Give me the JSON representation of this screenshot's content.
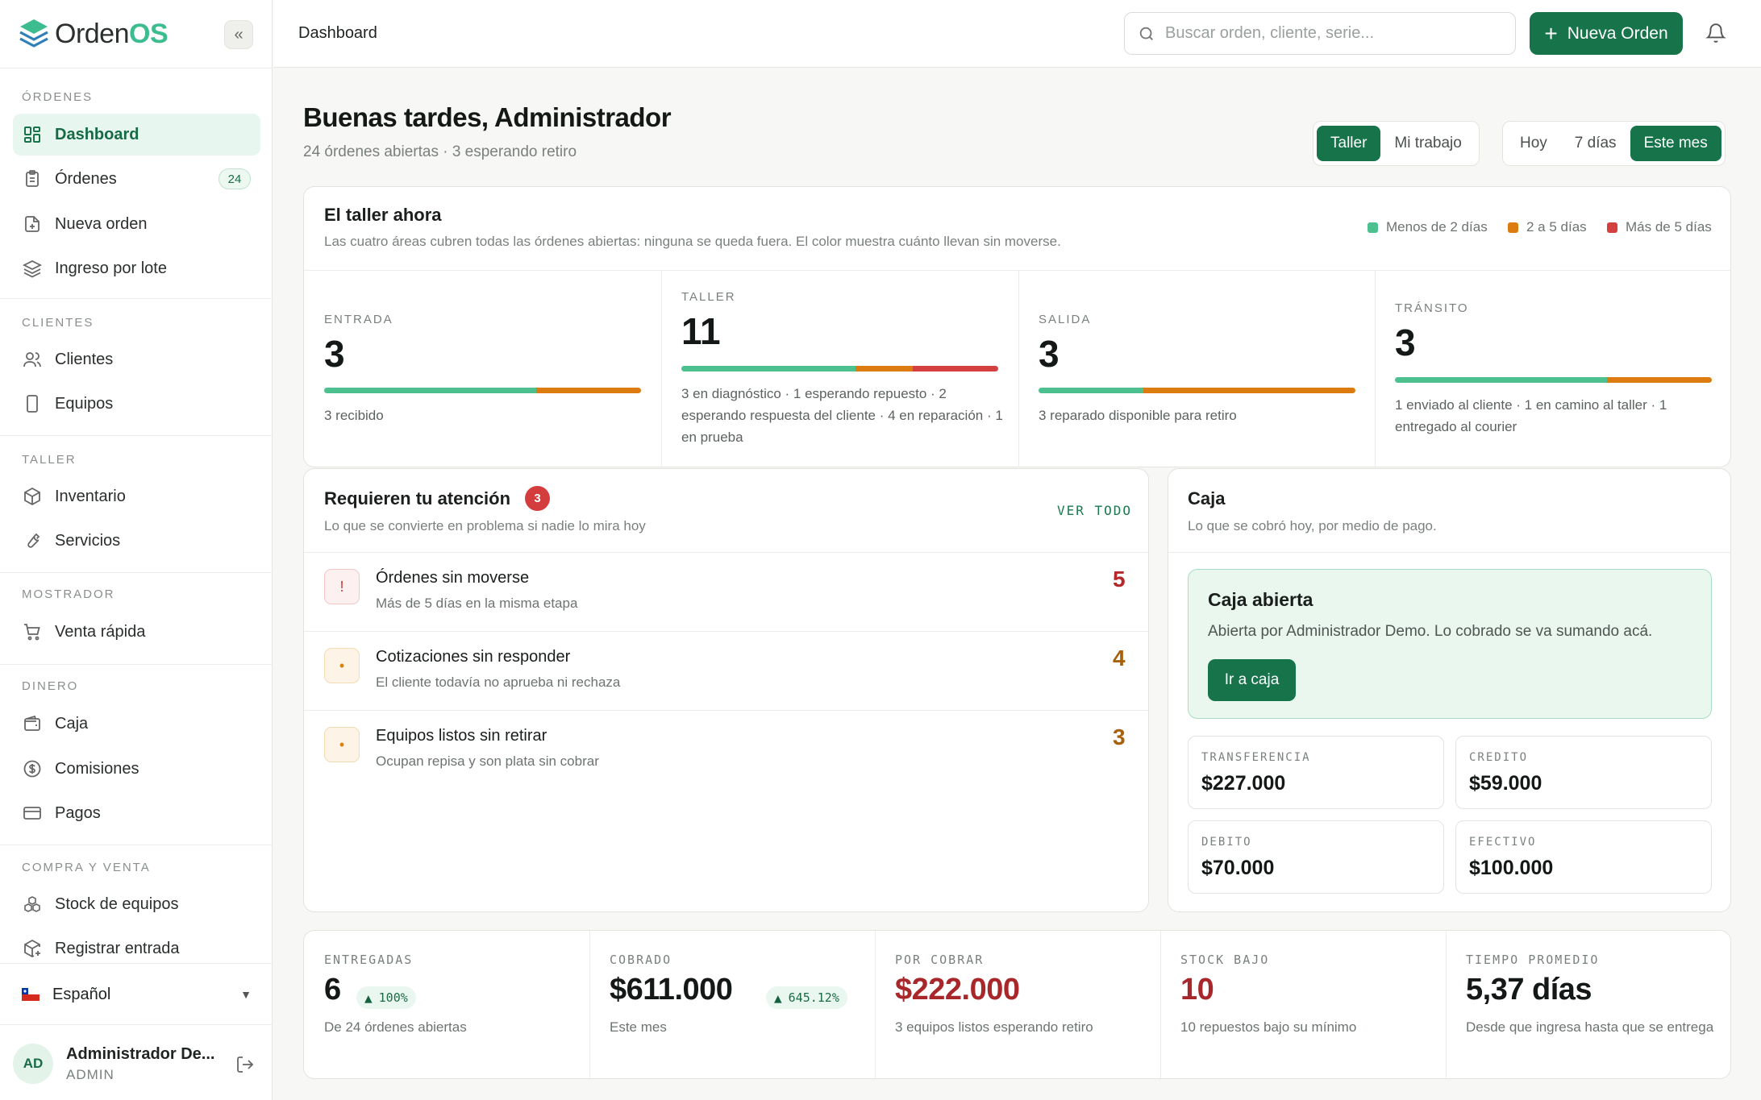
{
  "brand": {
    "name_prefix": "Orden",
    "name_suffix": "OS"
  },
  "sidebar": {
    "sections": {
      "ordenes": "ÓRDENES",
      "clientes": "CLIENTES",
      "taller": "TALLER",
      "mostrador": "MOSTRADOR",
      "dinero": "DINERO",
      "compra_venta": "COMPRA Y VENTA"
    },
    "items": {
      "dashboard": "Dashboard",
      "ordenes": "Órdenes",
      "ordenes_badge": "24",
      "nueva_orden": "Nueva orden",
      "ingreso_lote": "Ingreso por lote",
      "clientes": "Clientes",
      "equipos": "Equipos",
      "inventario": "Inventario",
      "servicios": "Servicios",
      "venta_rapida": "Venta rápida",
      "caja": "Caja",
      "comisiones": "Comisiones",
      "pagos": "Pagos",
      "stock_equipos": "Stock de equipos",
      "registrar_entrada": "Registrar entrada"
    },
    "language": "Español",
    "user": {
      "initials": "AD",
      "name": "Administrador De...",
      "role": "ADMIN"
    }
  },
  "topbar": {
    "breadcrumb": "Dashboard",
    "search_placeholder": "Buscar orden, cliente, serie...",
    "new_order_label": "Nueva Orden"
  },
  "header": {
    "greeting": "Buenas tardes, Administrador",
    "subtitle": "24 órdenes abiertas · 3 esperando retiro",
    "scope_tabs": [
      "Taller",
      "Mi trabajo"
    ],
    "scope_active": "Taller",
    "period_tabs": [
      "Hoy",
      "7 días",
      "Este mes"
    ],
    "period_active": "Este mes"
  },
  "workshop": {
    "title": "El taller ahora",
    "subtitle": "Las cuatro áreas cubren todas las órdenes abiertas: ninguna se queda fuera. El color muestra cuánto llevan sin moverse.",
    "legend": [
      {
        "label": "Menos de 2 días",
        "color": "#4cc08f"
      },
      {
        "label": "2 a 5 días",
        "color": "#dc7b10"
      },
      {
        "label": "Más de 5 días",
        "color": "#d44040"
      }
    ],
    "stages": [
      {
        "label": "ENTRADA",
        "count": "3",
        "desc": "3 recibido",
        "split": [
          0.67,
          0.33,
          0
        ]
      },
      {
        "label": "TALLER",
        "count": "11",
        "desc": "3 en diagnóstico · 1 esperando repuesto · 2 esperando respuesta del cliente · 4 en reparación · 1 en prueba",
        "split": [
          0.55,
          0.18,
          0.27
        ]
      },
      {
        "label": "SALIDA",
        "count": "3",
        "desc": "3 reparado disponible para retiro",
        "split": [
          0.33,
          0.67,
          0
        ]
      },
      {
        "label": "TRÁNSITO",
        "count": "3",
        "desc": "1 enviado al cliente · 1 en camino al taller · 1 entregado al courier",
        "split": [
          0.67,
          0.33,
          0
        ]
      }
    ]
  },
  "attention": {
    "title": "Requieren tu atención",
    "badge": "3",
    "subtitle": "Lo que se convierte en problema si nadie lo mira hoy",
    "view_all": "VER TODO",
    "items": [
      {
        "title": "Órdenes sin moverse",
        "sub": "Más de 5 días en la misma etapa",
        "count": "5",
        "icon": "!",
        "color": "#b4272a"
      },
      {
        "title": "Cotizaciones sin responder",
        "sub": "El cliente todavía no aprueba ni rechaza",
        "count": "4",
        "icon": "•",
        "color": "#a8600b"
      },
      {
        "title": "Equipos listos sin retirar",
        "sub": "Ocupan repisa y son plata sin cobrar",
        "count": "3",
        "icon": "•",
        "color": "#a8600b"
      }
    ]
  },
  "caja": {
    "title": "Caja",
    "subtitle": "Lo que se cobró hoy, por medio de pago.",
    "open_title": "Caja abierta",
    "open_sub": "Abierta por Administrador Demo. Lo cobrado se va sumando acá.",
    "button": "Ir a caja",
    "payments": [
      {
        "label": "TRANSFERENCIA",
        "value": "$227.000"
      },
      {
        "label": "CREDITO",
        "value": "$59.000"
      },
      {
        "label": "DEBITO",
        "value": "$70.000"
      },
      {
        "label": "EFECTIVO",
        "value": "$100.000"
      }
    ]
  },
  "kpis": [
    {
      "label": "ENTREGADAS",
      "value": "6",
      "delta": "100%",
      "sub": "De 24 órdenes abiertas"
    },
    {
      "label": "COBRADO",
      "value": "$611.000",
      "delta": "645.12%",
      "sub": "Este mes"
    },
    {
      "label": "POR COBRAR",
      "value": "$222.000",
      "sub": "3 equipos listos esperando retiro"
    },
    {
      "label": "STOCK BAJO",
      "value": "10",
      "sub": "10 repuestos bajo su mínimo"
    },
    {
      "label": "TIEMPO PROMEDIO",
      "value": "5,37 días",
      "sub": "Desde que ingresa hasta que se entrega"
    }
  ]
}
